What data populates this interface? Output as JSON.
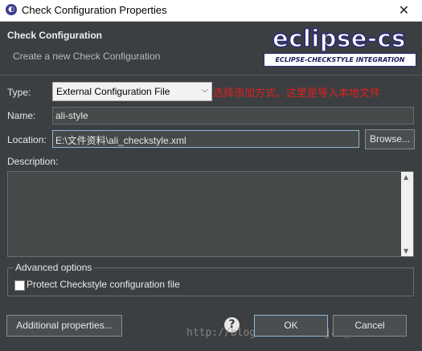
{
  "window": {
    "title": "Check Configuration Properties",
    "close_glyph": "✕"
  },
  "banner": {
    "heading": "Check Configuration",
    "subtitle": "Create a new Check Configuration",
    "logo_word": "eclipse-cs",
    "logo_strip": "ECLIPSE-CHECKSTYLE INTEGRATION"
  },
  "form": {
    "type_label": "Type:",
    "type_value": "External Configuration File",
    "type_annotation": "选择添加方式。这里是导入本地文件",
    "name_label": "Name:",
    "name_value": "ali-style",
    "location_label": "Location:",
    "location_value": "E:\\文件资料\\ali_checkstyle.xml",
    "browse_label": "Browse...",
    "description_label": "Description:",
    "description_value": ""
  },
  "advanced": {
    "legend": "Advanced options",
    "protect_label": "Protect Checkstyle configuration file",
    "protect_checked": false
  },
  "footer": {
    "additional_label": "Additional properties...",
    "help_glyph": "?",
    "ok_label": "OK",
    "cancel_label": "Cancel",
    "watermark": "http://blog.csdn.net/Ajax_mt"
  },
  "colors": {
    "dialog_bg": "#3c3f41",
    "annotation": "#e02020",
    "logo_blue": "#2a2a7a"
  }
}
